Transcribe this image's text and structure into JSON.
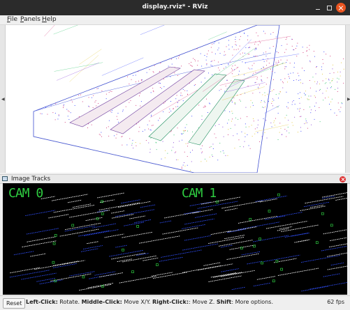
{
  "window": {
    "title": "display.rviz* - RViz",
    "controls": [
      "minimize-icon",
      "maximize-icon",
      "close-icon"
    ],
    "close_color": "#e95420"
  },
  "menu": {
    "items": [
      {
        "label": "File",
        "mnemonic": "F",
        "rest": "ile"
      },
      {
        "label": "Panels",
        "mnemonic": "P",
        "rest": "anels"
      },
      {
        "label": "Help",
        "mnemonic": "H",
        "rest": "elp"
      }
    ]
  },
  "viewport": {
    "background": "#ffffff",
    "point_colors": [
      "#2030ff",
      "#d0206a",
      "#20c060",
      "#e0c020",
      "#7b2bd6"
    ]
  },
  "panel": {
    "title": "Image Tracks",
    "cams": [
      "CAM 0",
      "CAM 1"
    ],
    "cam_color": "#2ecc40",
    "background": "#000000",
    "track_colors": [
      "#ffffff",
      "#3050ff",
      "#2ecc40"
    ]
  },
  "status": {
    "reset_label": "Reset",
    "parts": [
      {
        "b": "Left-Click:",
        "t": " Rotate. "
      },
      {
        "b": "Middle-Click:",
        "t": " Move X/Y. "
      },
      {
        "b": "Right-Click:",
        "t": ": Move Z. "
      },
      {
        "b": "Shift",
        "t": ": More options."
      }
    ],
    "fps": "62 fps"
  }
}
